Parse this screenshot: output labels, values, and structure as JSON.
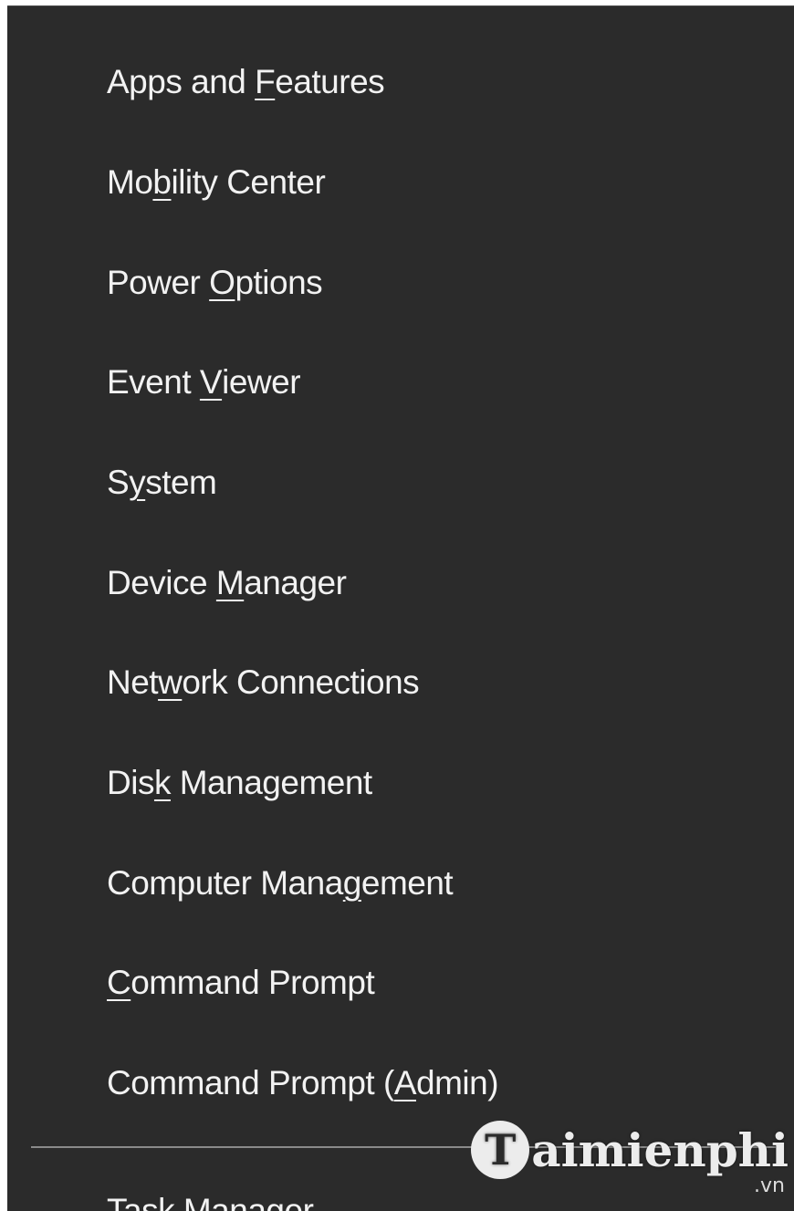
{
  "menu": {
    "items": [
      {
        "pre": "Apps and ",
        "key": "F",
        "post": "eatures"
      },
      {
        "pre": "Mo",
        "key": "b",
        "post": "ility Center"
      },
      {
        "pre": "Power ",
        "key": "O",
        "post": "ptions"
      },
      {
        "pre": "Event ",
        "key": "V",
        "post": "iewer"
      },
      {
        "pre": "S",
        "key": "y",
        "post": "stem"
      },
      {
        "pre": "Device ",
        "key": "M",
        "post": "anager"
      },
      {
        "pre": "Net",
        "key": "w",
        "post": "ork Connections"
      },
      {
        "pre": "Dis",
        "key": "k",
        "post": " Management"
      },
      {
        "pre": "Computer Mana",
        "key": "g",
        "post": "ement"
      },
      {
        "pre": "",
        "key": "C",
        "post": "ommand Prompt"
      },
      {
        "pre": "Command Prompt (",
        "key": "A",
        "post": "dmin)"
      },
      {
        "pre": "Task Manager",
        "key": "",
        "post": ""
      }
    ]
  },
  "watermark": {
    "logo_letter": "T",
    "text": "aimienphi",
    "suffix": ".vn"
  },
  "colors": {
    "menu_background": "#2b2b2b",
    "menu_text": "#f2f2f2",
    "separator": "#8a8a8a"
  }
}
